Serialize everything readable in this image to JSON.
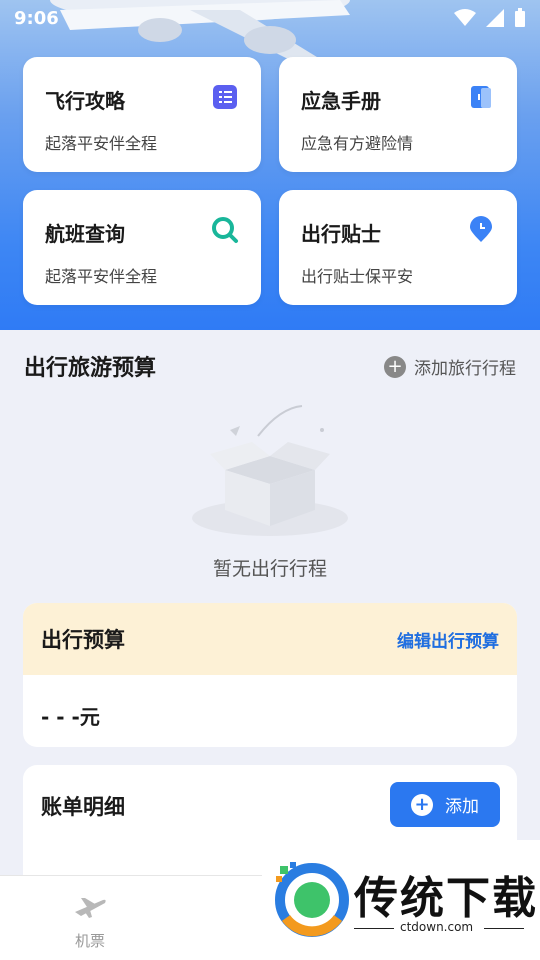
{
  "status": {
    "time": "9:06"
  },
  "cards": [
    {
      "title": "飞行攻略",
      "subtitle": "起落平安伴全程",
      "icon": "document-icon"
    },
    {
      "title": "应急手册",
      "subtitle": "应急有方避险情",
      "icon": "book-icon"
    },
    {
      "title": "航班查询",
      "subtitle": "起落平安伴全程",
      "icon": "search-icon"
    },
    {
      "title": "出行贴士",
      "subtitle": "出行贴士保平安",
      "icon": "location-pin-icon"
    }
  ],
  "trip_section": {
    "title": "出行旅游预算",
    "add_label": "添加旅行行程",
    "empty_text": "暂无出行行程"
  },
  "budget": {
    "title": "出行预算",
    "edit_label": "编辑出行预算",
    "value": "- - -元"
  },
  "bills": {
    "title": "账单明细",
    "add_label": "添加"
  },
  "nav": {
    "tickets_label": "机票"
  },
  "watermark": {
    "brand": "传统下载",
    "url": "ctdown.com"
  },
  "colors": {
    "accent": "#2b78f0",
    "budget_header": "#fdf1d6",
    "hero_gradient_bottom": "#2f7bf5"
  }
}
